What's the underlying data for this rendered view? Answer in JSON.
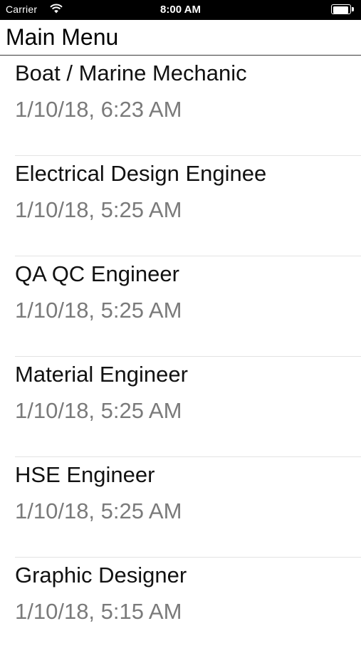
{
  "status_bar": {
    "carrier": "Carrier",
    "time": "8:00 AM",
    "battery_level": 1.0,
    "wifi_icon": "wifi-icon",
    "battery_icon": "battery-icon"
  },
  "nav": {
    "title": "Main Menu"
  },
  "items": [
    {
      "title": "Boat / Marine Mechanic",
      "date": "1/10/18, 6:23 AM"
    },
    {
      "title": "Electrical Design Enginee",
      "date": "1/10/18, 5:25 AM"
    },
    {
      "title": "QA QC Engineer",
      "date": "1/10/18, 5:25 AM"
    },
    {
      "title": "Material Engineer",
      "date": "1/10/18, 5:25 AM"
    },
    {
      "title": "HSE Engineer",
      "date": "1/10/18, 5:25 AM"
    },
    {
      "title": "Graphic Designer",
      "date": "1/10/18, 5:15 AM"
    }
  ]
}
